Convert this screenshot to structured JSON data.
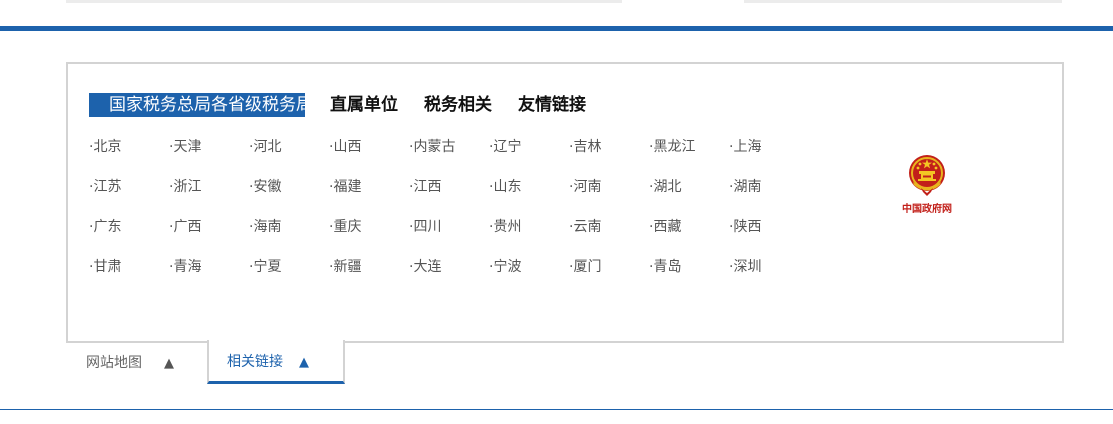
{
  "colors": {
    "accent": "#1d62ac",
    "border": "#d3d3d3",
    "emblem_red": "#c2201a"
  },
  "categories": [
    {
      "label": "国家税务总局各省级税务局",
      "active": true
    },
    {
      "label": "直属单位",
      "active": false
    },
    {
      "label": "税务相关",
      "active": false
    },
    {
      "label": "友情链接",
      "active": false
    }
  ],
  "links": [
    "·北京",
    "·天津",
    "·河北",
    "·山西",
    "·内蒙古",
    "·辽宁",
    "·吉林",
    "·黑龙江",
    "·上海",
    "·江苏",
    "·浙江",
    "·安徽",
    "·福建",
    "·江西",
    "·山东",
    "·河南",
    "·湖北",
    "·湖南",
    "·广东",
    "·广西",
    "·海南",
    "·重庆",
    "·四川",
    "·贵州",
    "·云南",
    "·西藏",
    "·陕西",
    "·甘肃",
    "·青海",
    "·宁夏",
    "·新疆",
    "·大连",
    "·宁波",
    "·厦门",
    "·青岛",
    "·深圳"
  ],
  "emblem": {
    "icon": "national-emblem-icon",
    "caption": "中国政府网"
  },
  "bottom_tabs": [
    {
      "label": "网站地图",
      "arrow": "▲",
      "active": false
    },
    {
      "label": "相关链接",
      "arrow": "▲",
      "active": true
    }
  ]
}
